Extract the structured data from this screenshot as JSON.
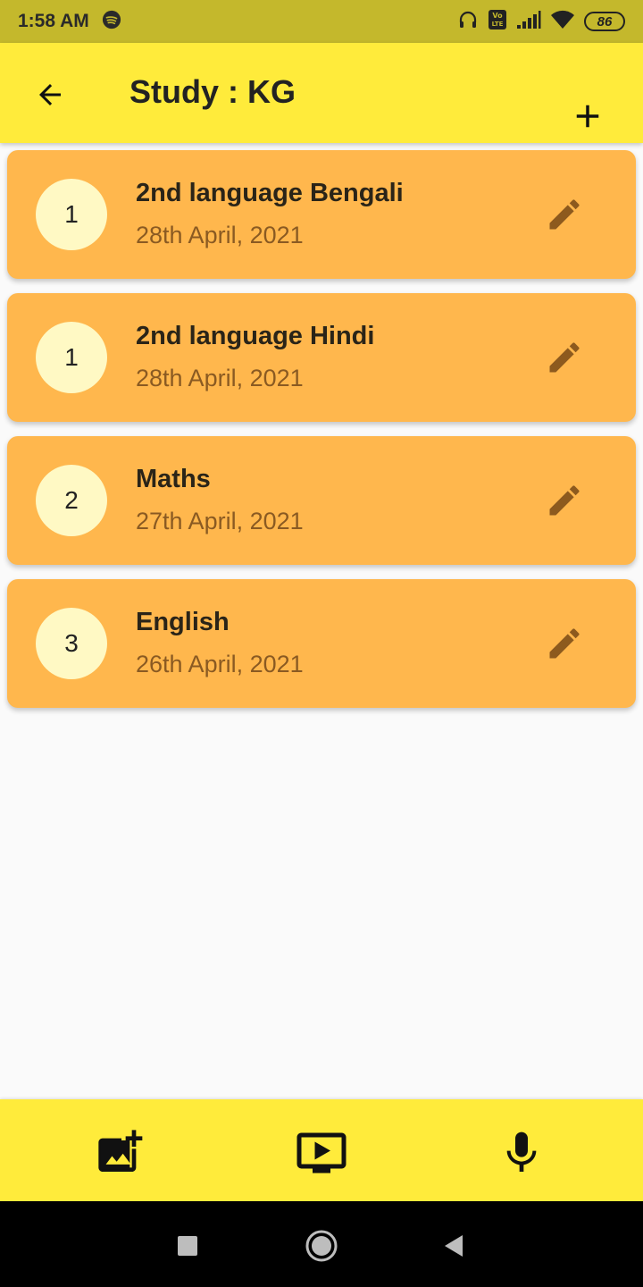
{
  "status_bar": {
    "time": "1:58 AM",
    "battery": "86",
    "icons": [
      "spotify-icon",
      "headset-icon",
      "volte-icon",
      "signal-icon",
      "wifi-icon",
      "battery-icon"
    ]
  },
  "app_bar": {
    "title": "Study : KG",
    "back_icon": "arrow-back-icon",
    "add_icon": "plus-icon"
  },
  "items": [
    {
      "count": "1",
      "subject": "2nd language Bengali",
      "date": "28th April, 2021"
    },
    {
      "count": "1",
      "subject": "2nd language Hindi",
      "date": "28th April, 2021"
    },
    {
      "count": "2",
      "subject": "Maths",
      "date": "27th April, 2021"
    },
    {
      "count": "3",
      "subject": "English",
      "date": "26th April, 2021"
    }
  ],
  "bottom_bar": {
    "buttons": [
      "add-photo-icon",
      "video-icon",
      "mic-icon"
    ]
  },
  "nav_bar": {
    "buttons": [
      "recents-icon",
      "home-icon",
      "back-icon"
    ]
  },
  "colors": {
    "status_bar": "#c4b82c",
    "app_bar": "#ffeb3b",
    "card": "#ffb74d",
    "badge": "#fff9c4",
    "date_text": "#8a5a22",
    "edit_icon": "#8d5a1e"
  }
}
